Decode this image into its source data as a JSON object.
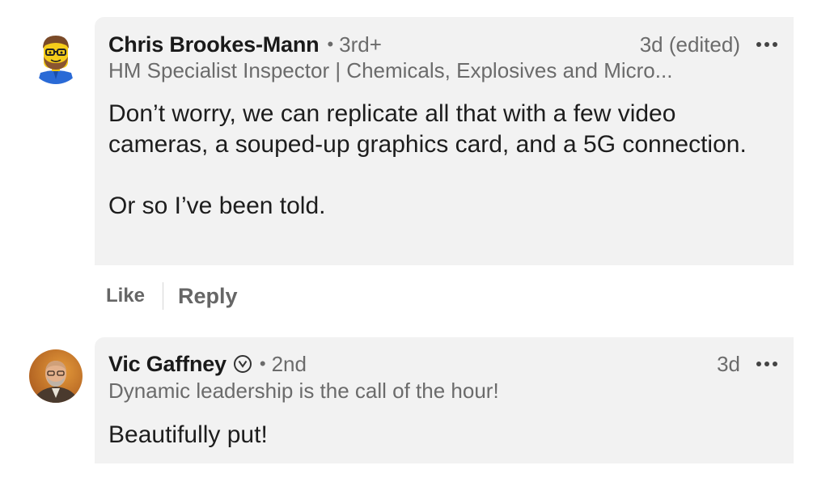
{
  "comments": [
    {
      "author": "Chris Brookes-Mann",
      "degree": "3rd+",
      "time": "3d (edited)",
      "headline": "HM Specialist Inspector | Chemicals, Explosives and Micro...",
      "body": "Don’t worry, we can replicate all that with a few video cameras, a souped-up graphics card, and a 5G connection.\n\nOr so I’ve been told.",
      "avatar_icon": "lego-avatar-icon"
    },
    {
      "author": "Vic Gaffney",
      "degree": "2nd",
      "time": "3d",
      "headline": "Dynamic leadership is the call of the hour!",
      "body": "Beautifully put!",
      "avatar_icon": "profile-photo-icon",
      "badge_icon": "verified-badge-icon"
    }
  ],
  "actions": {
    "like_label": "Like",
    "reply_label": "Reply"
  },
  "separator": "•",
  "colors": {
    "bubble_bg": "#f2f2f2",
    "secondary_text": "#6b6b6b",
    "primary_text": "#1d1d1d"
  }
}
